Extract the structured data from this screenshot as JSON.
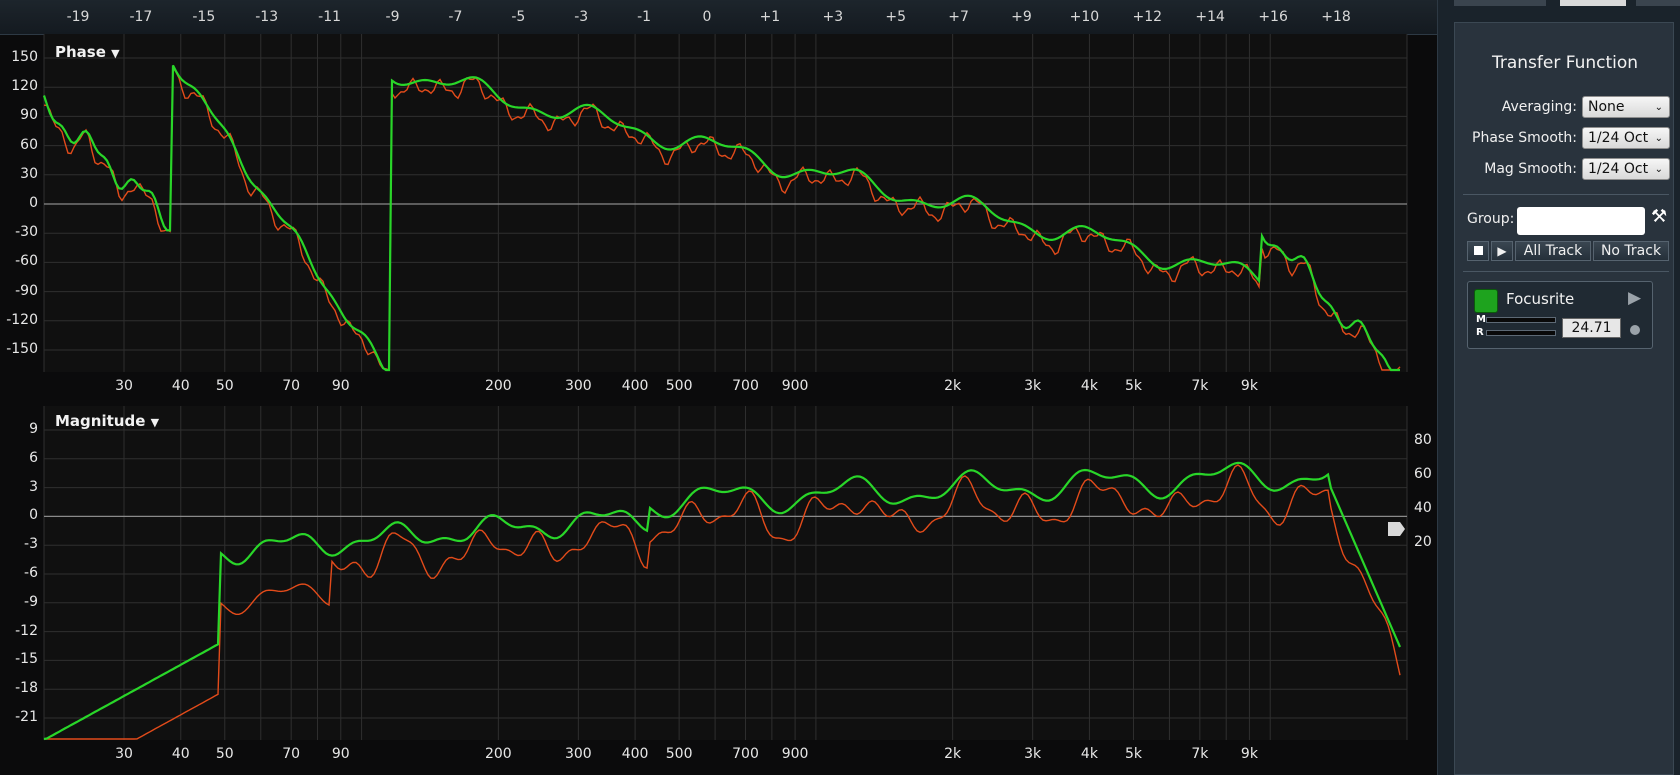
{
  "ruler": {
    "labels": [
      "-19",
      "-17",
      "-15",
      "-13",
      "-11",
      "-9",
      "-7",
      "-5",
      "-3",
      "-1",
      "0",
      "+1",
      "+3",
      "+5",
      "+7",
      "+9",
      "+10",
      "+12",
      "+14",
      "+16",
      "+18"
    ]
  },
  "phase_panel": {
    "title": "Phase",
    "y_ticks": [
      "150",
      "120",
      "90",
      "60",
      "30",
      "0",
      "-30",
      "-60",
      "-90",
      "-120",
      "-150"
    ],
    "x_ticks": [
      "30",
      "40",
      "50",
      "70",
      "90",
      "200",
      "300",
      "400",
      "500",
      "700",
      "900",
      "2k",
      "3k",
      "4k",
      "5k",
      "7k",
      "9k"
    ]
  },
  "magnitude_panel": {
    "title": "Magnitude",
    "y_ticks_left": [
      "9",
      "6",
      "3",
      "0",
      "-3",
      "-6",
      "-9",
      "-12",
      "-15",
      "-18",
      "-21"
    ],
    "y_ticks_right": [
      "80",
      "60",
      "40",
      "20"
    ],
    "x_ticks": [
      "30",
      "40",
      "50",
      "70",
      "90",
      "200",
      "300",
      "400",
      "500",
      "700",
      "900",
      "2k",
      "3k",
      "4k",
      "5k",
      "7k",
      "9k"
    ]
  },
  "colors": {
    "trace_primary": "#29d629",
    "trace_secondary": "#e24b1a",
    "panel_bg": "#101010",
    "grid": "#2f2f2f",
    "sidebar_bg": "#29333d"
  },
  "sidebar": {
    "title": "Transfer Function",
    "averaging_label": "Averaging:",
    "averaging_value": "None",
    "phase_smooth_label": "Phase Smooth:",
    "phase_smooth_value": "1/24 Oct",
    "mag_smooth_label": "Mag Smooth:",
    "mag_smooth_value": "1/24 Oct",
    "group_label": "Group:",
    "all_track_label": "All Track",
    "no_track_label": "No Track",
    "device_name": "Focusrite",
    "meter_m_label": "M",
    "meter_r_label": "R",
    "delay_value": "24.71"
  }
}
